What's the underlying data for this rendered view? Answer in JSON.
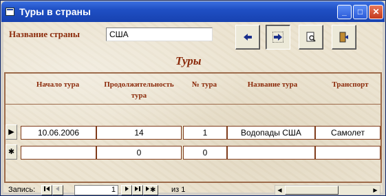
{
  "window": {
    "title": "Туры в страны",
    "minimize": "_",
    "maximize": "□",
    "close": "✕"
  },
  "header": {
    "country_label": "Название страны",
    "country_value": "США"
  },
  "toolbar": [
    {
      "icon": "arrow-left-icon"
    },
    {
      "icon": "arrow-right-icon"
    },
    {
      "icon": "preview-icon"
    },
    {
      "icon": "exit-door-icon"
    }
  ],
  "subform": {
    "title": "Туры",
    "columns": [
      "Начало тура",
      "Продолжительность тура",
      "№ тура",
      "Название тура",
      "Транспорт"
    ],
    "rows": [
      {
        "selector": "▶",
        "cells": [
          "10.06.2006",
          "14",
          "1",
          "Водопады США",
          "Самолет"
        ]
      },
      {
        "selector": "✱",
        "cells": [
          "",
          "0",
          "0",
          "",
          ""
        ]
      }
    ]
  },
  "navigation": {
    "record_label": "Запись:",
    "record_value": "1",
    "of_label": "из",
    "total": "1"
  },
  "colors": {
    "label": "#8b2a0a",
    "titlebar": "#1f4fc4",
    "cell_border": "#7f3b1a"
  }
}
